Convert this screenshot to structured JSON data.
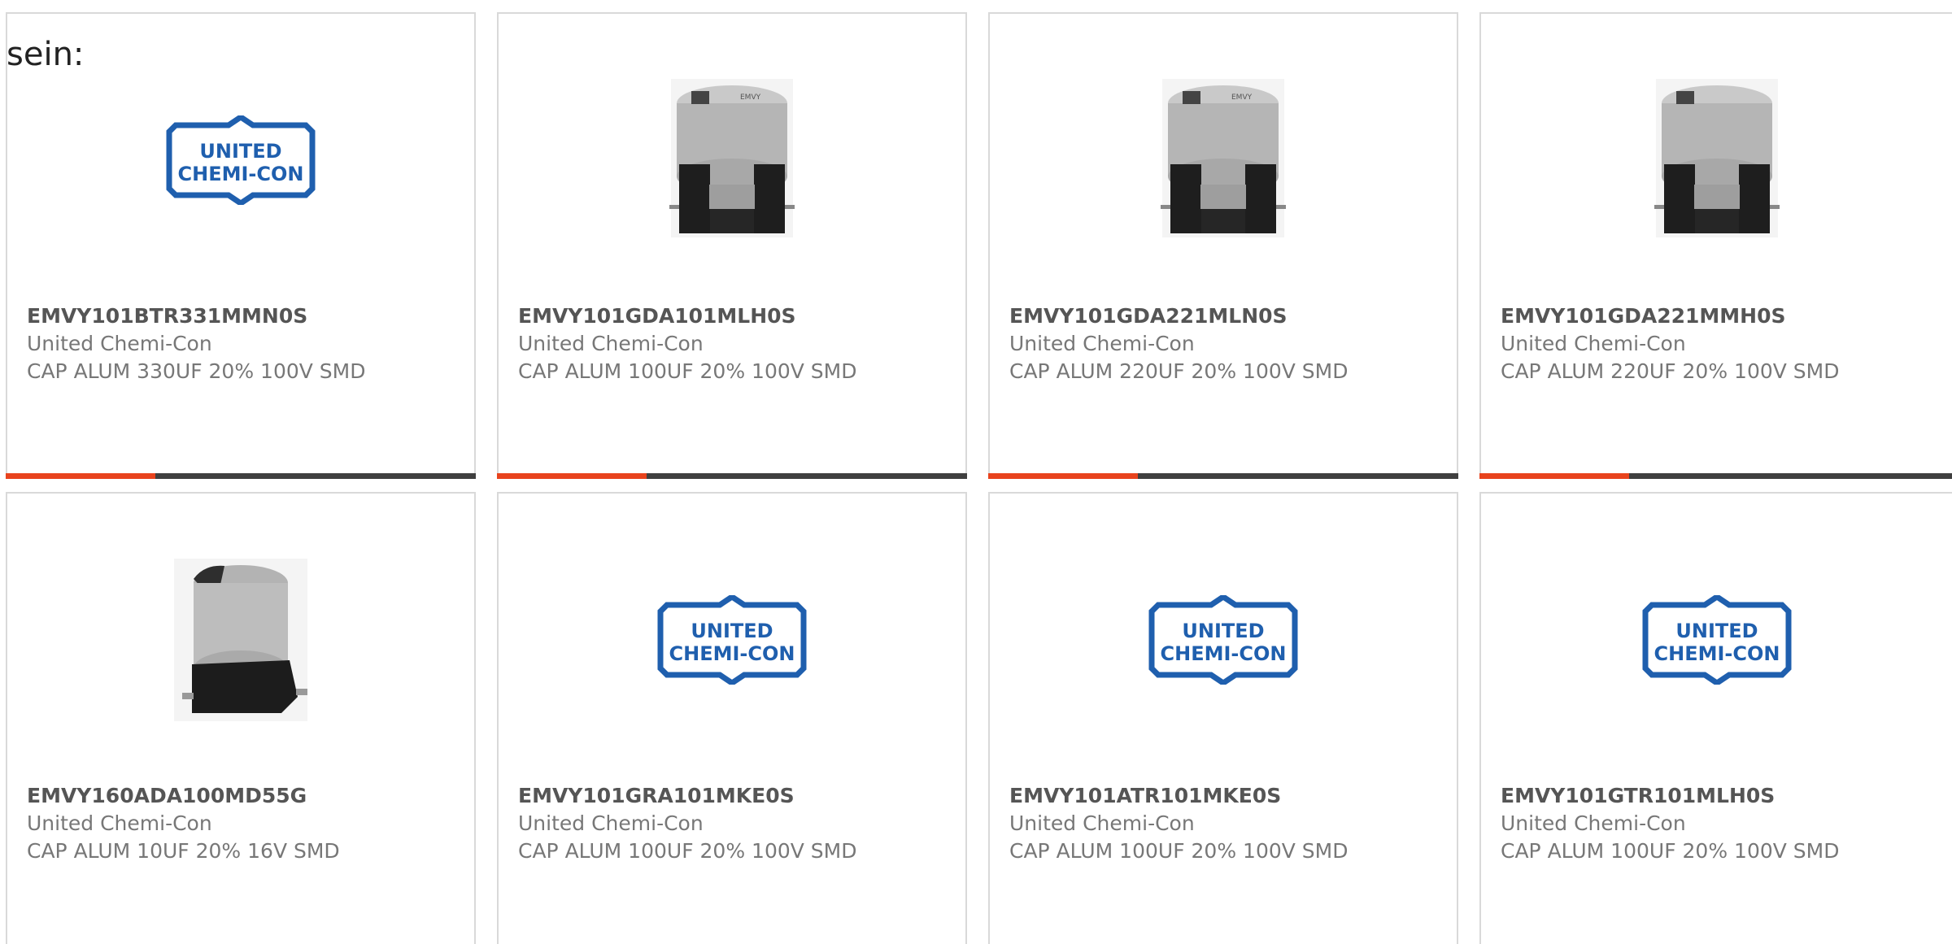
{
  "intro": {
    "text": "sein:"
  },
  "colors": {
    "accent": "#e8431d",
    "bar": "#3f3f3f",
    "logo_blue": "#1f5fae",
    "border": "#d9d9d9"
  },
  "products": [
    {
      "part": "EMVY101BTR331MMN0S",
      "manufacturer": "United Chemi-Con",
      "description": "CAP ALUM 330UF 20% 100V SMD",
      "image": "logo",
      "logo_line1": "UNITED",
      "logo_line2": "CHEMI-CON"
    },
    {
      "part": "EMVY101GDA101MLH0S",
      "manufacturer": "United Chemi-Con",
      "description": "CAP ALUM 100UF 20% 100V SMD",
      "image": "capacitor-tall"
    },
    {
      "part": "EMVY101GDA221MLN0S",
      "manufacturer": "United Chemi-Con",
      "description": "CAP ALUM 220UF 20% 100V SMD",
      "image": "capacitor-tall"
    },
    {
      "part": "EMVY101GDA221MMH0S",
      "manufacturer": "United Chemi-Con",
      "description": "CAP ALUM 220UF 20% 100V SMD",
      "image": "capacitor-tall"
    },
    {
      "part": "EMVY160ADA100MD55G",
      "manufacturer": "United Chemi-Con",
      "description": "CAP ALUM 10UF 20% 16V SMD",
      "image": "capacitor-small"
    },
    {
      "part": "EMVY101GRA101MKE0S",
      "manufacturer": "United Chemi-Con",
      "description": "CAP ALUM 100UF 20% 100V SMD",
      "image": "logo",
      "logo_line1": "UNITED",
      "logo_line2": "CHEMI-CON"
    },
    {
      "part": "EMVY101ATR101MKE0S",
      "manufacturer": "United Chemi-Con",
      "description": "CAP ALUM 100UF 20% 100V SMD",
      "image": "logo",
      "logo_line1": "UNITED",
      "logo_line2": "CHEMI-CON"
    },
    {
      "part": "EMVY101GTR101MLH0S",
      "manufacturer": "United Chemi-Con",
      "description": "CAP ALUM 100UF 20% 100V SMD",
      "image": "logo",
      "logo_line1": "UNITED",
      "logo_line2": "CHEMI-CON"
    }
  ]
}
